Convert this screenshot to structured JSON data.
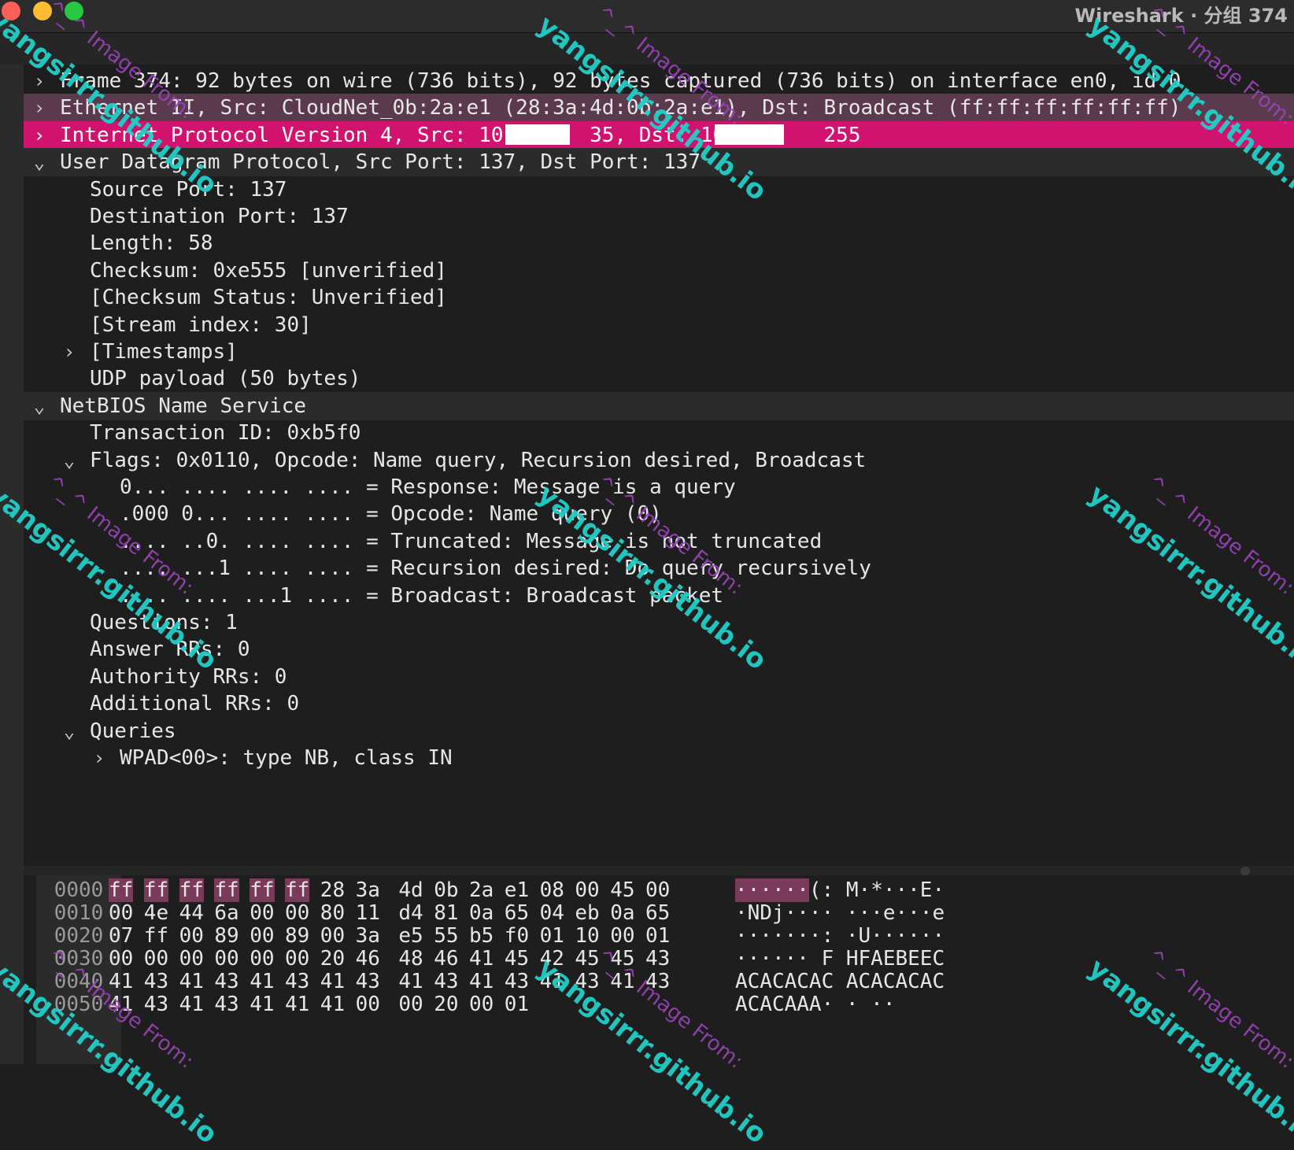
{
  "window": {
    "title": "Wireshark · 分组 374"
  },
  "tree": {
    "rows": [
      {
        "arrow": "›",
        "text": "Frame 374: 92 bytes on wire (736 bits), 92 bytes captured (736 bits) on interface en0, id 0"
      },
      {
        "arrow": "›",
        "text": "Ethernet II, Src: CloudNet_0b:2a:e1 (28:3a:4d:0b:2a:e1), Dst: Broadcast (ff:ff:ff:ff:ff:ff)"
      },
      {
        "arrow": "›",
        "text": "Internet Protocol Version 4, Src: 10.      35, Dst: 10.       255"
      },
      {
        "arrow": "⌄",
        "text": "User Datagram Protocol, Src Port: 137, Dst Port: 137"
      },
      {
        "arrow": "",
        "text": "Source Port: 137"
      },
      {
        "arrow": "",
        "text": "Destination Port: 137"
      },
      {
        "arrow": "",
        "text": "Length: 58"
      },
      {
        "arrow": "",
        "text": "Checksum: 0xe555 [unverified]"
      },
      {
        "arrow": "",
        "text": "[Checksum Status: Unverified]"
      },
      {
        "arrow": "",
        "text": "[Stream index: 30]"
      },
      {
        "arrow": "›",
        "text": "[Timestamps]"
      },
      {
        "arrow": "",
        "text": "UDP payload (50 bytes)"
      },
      {
        "arrow": "⌄",
        "text": "NetBIOS Name Service"
      },
      {
        "arrow": "",
        "text": "Transaction ID: 0xb5f0"
      },
      {
        "arrow": "⌄",
        "text": "Flags: 0x0110, Opcode: Name query, Recursion desired, Broadcast"
      },
      {
        "arrow": "",
        "text": "0... .... .... .... = Response: Message is a query"
      },
      {
        "arrow": "",
        "text": ".000 0... .... .... = Opcode: Name query (0)"
      },
      {
        "arrow": "",
        "text": ".... ..0. .... .... = Truncated: Message is not truncated"
      },
      {
        "arrow": "",
        "text": ".... ...1 .... .... = Recursion desired: Do query recursively"
      },
      {
        "arrow": "",
        "text": ".... .... ...1 .... = Broadcast: Broadcast packet"
      },
      {
        "arrow": "",
        "text": "Questions: 1"
      },
      {
        "arrow": "",
        "text": "Answer RRs: 0"
      },
      {
        "arrow": "",
        "text": "Authority RRs: 0"
      },
      {
        "arrow": "",
        "text": "Additional RRs: 0"
      },
      {
        "arrow": "⌄",
        "text": "Queries"
      },
      {
        "arrow": "›",
        "text": "WPAD<00>: type NB, class IN"
      }
    ]
  },
  "hex": {
    "rows": [
      {
        "offset": "0000",
        "bytes": [
          "ff",
          "ff",
          "ff",
          "ff",
          "ff",
          "ff",
          "28",
          "3a",
          "4d",
          "0b",
          "2a",
          "e1",
          "08",
          "00",
          "45",
          "00"
        ],
        "ascii": "······(: M·*···E·"
      },
      {
        "offset": "0010",
        "bytes": [
          "00",
          "4e",
          "44",
          "6a",
          "00",
          "00",
          "80",
          "11",
          "d4",
          "81",
          "0a",
          "65",
          "04",
          "eb",
          "0a",
          "65"
        ],
        "ascii": "·NDj···· ···e···e"
      },
      {
        "offset": "0020",
        "bytes": [
          "07",
          "ff",
          "00",
          "89",
          "00",
          "89",
          "00",
          "3a",
          "e5",
          "55",
          "b5",
          "f0",
          "01",
          "10",
          "00",
          "01"
        ],
        "ascii": "·······: ·U······"
      },
      {
        "offset": "0030",
        "bytes": [
          "00",
          "00",
          "00",
          "00",
          "00",
          "00",
          "20",
          "46",
          "48",
          "46",
          "41",
          "45",
          "42",
          "45",
          "45",
          "43"
        ],
        "ascii": "······ F HFAEBEEC"
      },
      {
        "offset": "0040",
        "bytes": [
          "41",
          "43",
          "41",
          "43",
          "41",
          "43",
          "41",
          "43",
          "41",
          "43",
          "41",
          "43",
          "41",
          "43",
          "41",
          "43"
        ],
        "ascii": "ACACACAC ACACACAC"
      },
      {
        "offset": "0050",
        "bytes": [
          "41",
          "43",
          "41",
          "43",
          "41",
          "41",
          "41",
          "00",
          "00",
          "20",
          "00",
          "01"
        ],
        "ascii": "ACACAAA· · ··"
      }
    ]
  },
  "watermark": {
    "main": "yangsirrr.github.io",
    "sub": "^_^ Image From:"
  },
  "colors": {
    "selected_row": "#d1136f",
    "ethernet_row": "#5c3a4d",
    "hex_highlight": "#7a3a5a",
    "watermark_main": "#20d0c8",
    "watermark_sub": "#9a44b8"
  }
}
